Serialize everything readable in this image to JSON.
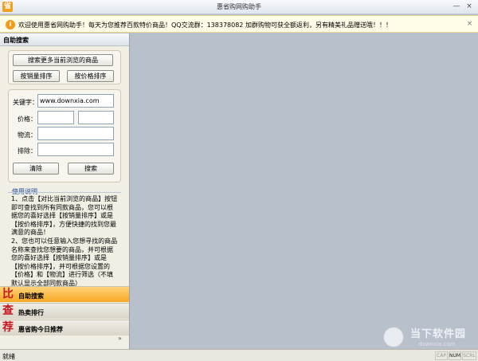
{
  "window": {
    "title": "惠省购网购助手",
    "app_icon": "省"
  },
  "notice": {
    "text": "欢迎使用惠省网购助手！每天为您推荐百款特价商品！QQ交流群：138378082 加群购物可获全额返利，另有精美礼品赠送哦！！！"
  },
  "left_panel": {
    "header": "自助搜索",
    "search_more_label": "搜索更多当前浏览的商品",
    "sort_sales_label": "按销量排序",
    "sort_price_label": "按价格排序",
    "keyword_label": "关键字：",
    "keyword_value": "www.downxia.com",
    "price_label": "价格：",
    "logistics_label": "物流：",
    "exclude_label": "排除：",
    "clear_label": "清除",
    "search_label": "搜索",
    "help_title": "使用说明",
    "help_p1": "1、点击【对比当前浏览的商品】按钮即可查找到所有同款商品，您可以根据您的喜好选择【按销量排序】或是【按价格排序】，方便快捷的找到您最满意的商品！",
    "help_p2": "2、您也可以任意输入您想寻找的商品名称来查找您想要的商品，并可根据您的喜好选择【按销量排序】或是【按价格排序】，并可根据您设置的【价格】和【物流】进行筛选（不填默认显示全部同款商品）"
  },
  "nav": [
    {
      "char": "比",
      "label": "自助搜索"
    },
    {
      "char": "查",
      "label": "热卖排行"
    },
    {
      "char": "荐",
      "label": "惠省购今日推荐"
    }
  ],
  "chevron": "»",
  "status": {
    "text": "就绪",
    "cap": "CAP",
    "num": "NUM",
    "scrl": "SCRL"
  },
  "watermark": {
    "main": "当下软件园",
    "sub": "downxia.com"
  },
  "colors": {
    "accent": "#f7a825",
    "nav_char": "#c6181e",
    "help_title": "#1e4c9a"
  }
}
